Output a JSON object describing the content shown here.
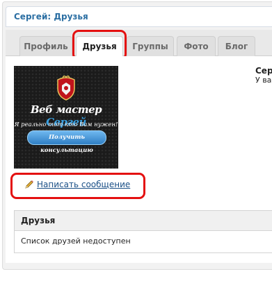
{
  "header": {
    "title": "Сергей: Друзья"
  },
  "tabs": [
    {
      "label": "Профиль",
      "active": false
    },
    {
      "label": "Друзья",
      "active": true
    },
    {
      "label": "Группы",
      "active": false
    },
    {
      "label": "Фото",
      "active": false
    },
    {
      "label": "Блог",
      "active": false
    }
  ],
  "banner": {
    "title_prefix": "Веб мастер",
    "title_name": "Сергей",
    "subtitle": "Я реально тот кто Вам нужен!",
    "button_label": "Получить консультацию",
    "logo_icon": "crest-icon"
  },
  "profile": {
    "name": "Серг",
    "status": "У ва"
  },
  "actions": {
    "send_message": "Написать сообщение",
    "send_message_icon": "pencil-icon"
  },
  "friends": {
    "heading": "Друзья",
    "empty_text": "Список друзей недоступен"
  },
  "colors": {
    "header_text": "#2c6fa3",
    "highlight": "#e41010",
    "link": "#1a4f86"
  }
}
